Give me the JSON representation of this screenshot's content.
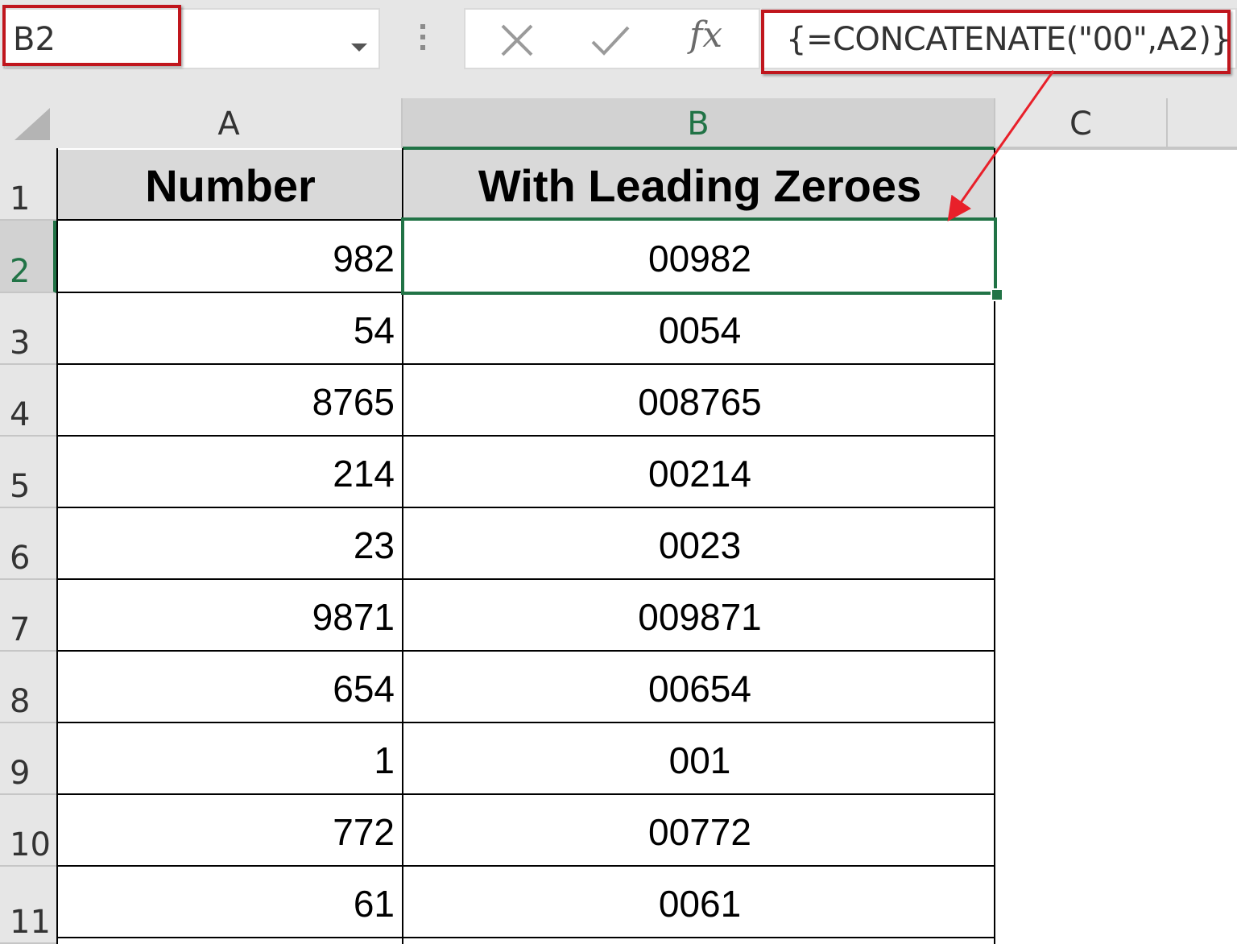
{
  "name_box": {
    "value": "B2"
  },
  "formula_bar": {
    "fx_label": "fx",
    "formula": "{=CONCATENATE(\"00\",A2)}"
  },
  "columns": [
    "A",
    "B",
    "C"
  ],
  "selected_cell": "B2",
  "sheet": {
    "header": {
      "row": "1",
      "a": "Number",
      "b": "With Leading Zeroes"
    },
    "rows": [
      {
        "row": "2",
        "a": "982",
        "b": "00982"
      },
      {
        "row": "3",
        "a": "54",
        "b": "0054"
      },
      {
        "row": "4",
        "a": "8765",
        "b": "008765"
      },
      {
        "row": "5",
        "a": "214",
        "b": "00214"
      },
      {
        "row": "6",
        "a": "23",
        "b": "0023"
      },
      {
        "row": "7",
        "a": "9871",
        "b": "009871"
      },
      {
        "row": "8",
        "a": "654",
        "b": "00654"
      },
      {
        "row": "9",
        "a": "1",
        "b": "001"
      },
      {
        "row": "10",
        "a": "772",
        "b": "00772"
      },
      {
        "row": "11",
        "a": "61",
        "b": "0061"
      }
    ]
  },
  "colors": {
    "highlight": "#c0161d",
    "selection": "#217346",
    "header_fill": "#d9d9d9"
  }
}
